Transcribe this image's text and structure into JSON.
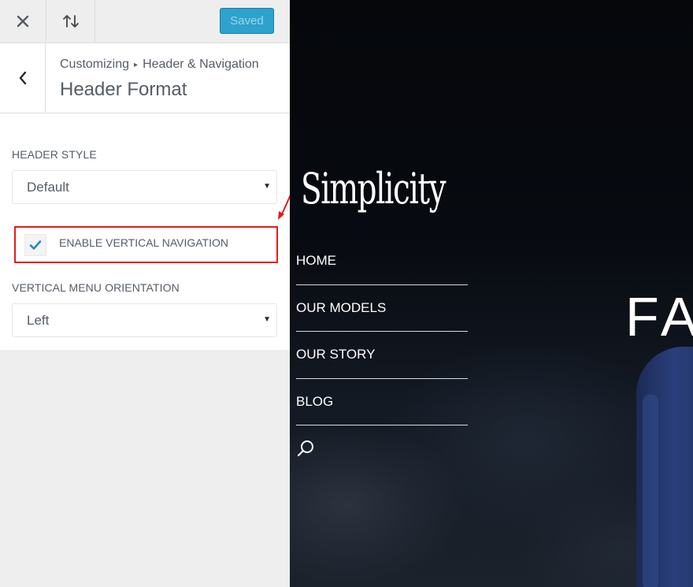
{
  "topbar": {
    "close_icon": "close-icon",
    "reorder_icon": "reorder-icon",
    "save_label": "Saved",
    "save_color": "#2ea2cc"
  },
  "breadcrumb": {
    "parent": "Customizing",
    "current": "Header & Navigation",
    "title": "Header Format"
  },
  "controls": {
    "header_style": {
      "label": "HEADER STYLE",
      "value": "Default"
    },
    "vertical_nav": {
      "label": "ENABLE VERTICAL NAVIGATION",
      "checked": true,
      "highlight_color": "#e41b1b"
    },
    "vertical_orientation": {
      "label": "VERTICAL MENU ORIENTATION",
      "value": "Left"
    }
  },
  "preview": {
    "logo": "Simplicity",
    "nav": [
      "HOME",
      "OUR MODELS",
      "OUR STORY",
      "BLOG"
    ],
    "search_icon": "search-icon",
    "hero_text": "FA"
  }
}
